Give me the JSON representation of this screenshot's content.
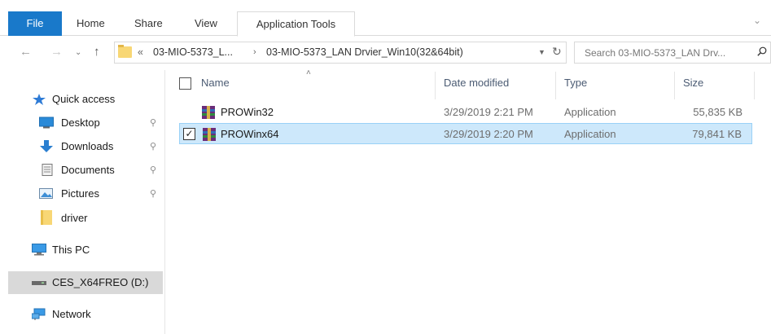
{
  "ribbon": {
    "tabs": [
      "File",
      "Home",
      "Share",
      "View",
      "Application Tools"
    ]
  },
  "address": {
    "overflow_glyph": "«",
    "segments": [
      "03-MIO-5373_L...",
      "03-MIO-5373_LAN Drvier_Win10(32&64bit)"
    ],
    "separator": "›"
  },
  "search": {
    "placeholder": "Search 03-MIO-5373_LAN Drv..."
  },
  "navpane": {
    "items": [
      {
        "label": "Quick access",
        "icon": "star-icon"
      },
      {
        "label": "Desktop",
        "icon": "desktop-icon",
        "pinned": true
      },
      {
        "label": "Downloads",
        "icon": "download-arrow-icon",
        "pinned": true
      },
      {
        "label": "Documents",
        "icon": "document-icon",
        "pinned": true
      },
      {
        "label": "Pictures",
        "icon": "pictures-icon",
        "pinned": true
      },
      {
        "label": "driver",
        "icon": "folder-icon"
      },
      {
        "label": "This PC",
        "icon": "computer-icon"
      },
      {
        "label": "CES_X64FREO (D:)",
        "icon": "drive-icon",
        "selected": true
      },
      {
        "label": "Network",
        "icon": "network-icon"
      }
    ]
  },
  "filelist": {
    "columns": [
      "Name",
      "Date modified",
      "Type",
      "Size"
    ],
    "rows": [
      {
        "name": "PROWin32",
        "date": "3/29/2019 2:21 PM",
        "type": "Application",
        "size": "55,835 KB",
        "selected": false
      },
      {
        "name": "PROWinx64",
        "date": "3/29/2019 2:20 PM",
        "type": "Application",
        "size": "79,841 KB",
        "selected": true
      }
    ]
  },
  "colors": {
    "accent": "#1979ca",
    "selection": "#cde8fb",
    "selection_border": "#99d1f7",
    "folder": "#f8d775"
  }
}
